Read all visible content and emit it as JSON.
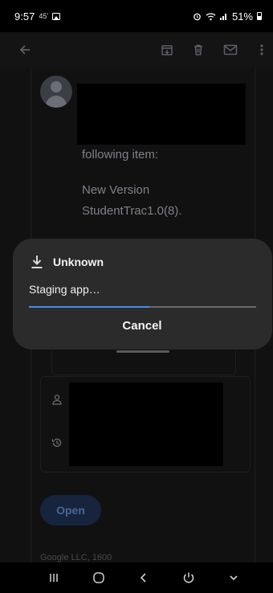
{
  "status_bar": {
    "time": "9:57",
    "small_indicator": "45'",
    "battery": "51%",
    "icons": [
      "image-icon",
      "alarm-icon",
      "wifi-icon",
      "signal-icon",
      "battery-icon"
    ]
  },
  "app_bar": {
    "icons": [
      "back-arrow-icon",
      "archive-icon",
      "delete-icon",
      "mail-icon",
      "more-vert-icon"
    ]
  },
  "email": {
    "line1": "following item:",
    "line2": "New Version",
    "line3": "StudentTrac1.0(8).",
    "open_button": "Open",
    "footer": "Google LLC, 1600"
  },
  "dialog": {
    "title": "Unknown",
    "status": "Staging app…",
    "progress": 0.53,
    "cancel_label": "Cancel",
    "accent_color": "#3f8ee6"
  },
  "nav_bar": {
    "icons": [
      "recents-icon",
      "home-icon",
      "back-icon",
      "assistant-icon",
      "hide-keyboard-icon"
    ]
  }
}
